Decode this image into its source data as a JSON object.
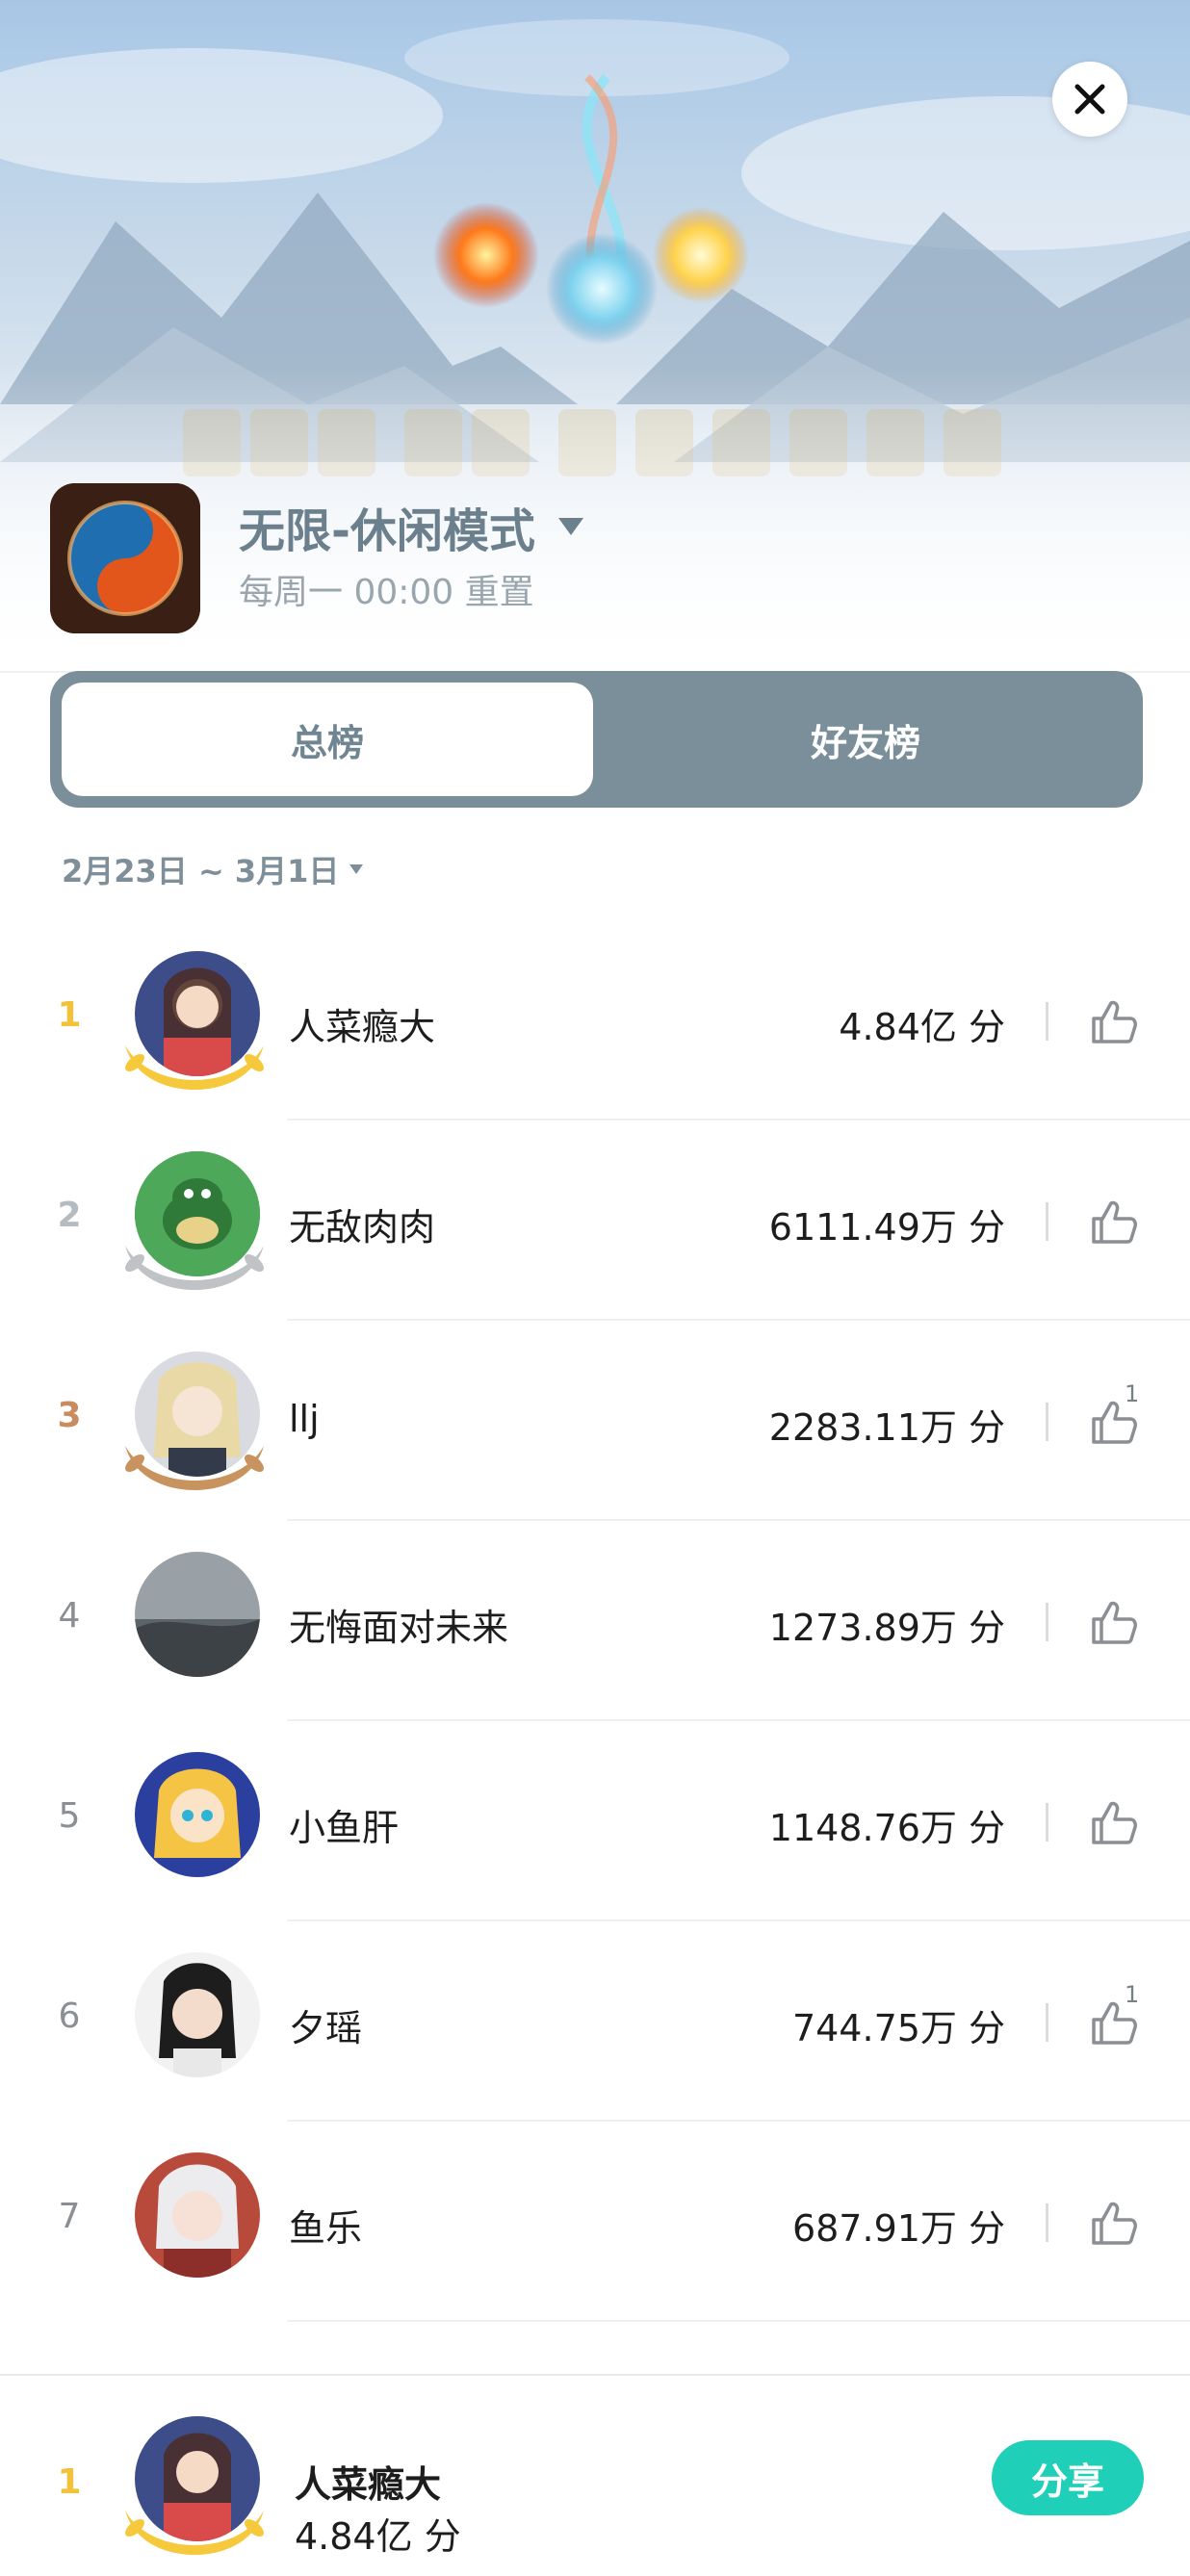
{
  "header": {
    "mode_title": "无限-休闲模式",
    "reset_text": "每周一 00:00 重置"
  },
  "tabs": [
    {
      "label": "总榜",
      "active": true
    },
    {
      "label": "好友榜",
      "active": false
    }
  ],
  "date_range": "2月23日 ~ 3月1日",
  "leaderboard": [
    {
      "rank": "1",
      "name": "人菜瘾大",
      "score": "4.84亿 分",
      "likes": ""
    },
    {
      "rank": "2",
      "name": "无敌肉肉",
      "score": "6111.49万 分",
      "likes": ""
    },
    {
      "rank": "3",
      "name": "llj",
      "score": "2283.11万 分",
      "likes": "1"
    },
    {
      "rank": "4",
      "name": "无悔面对未来",
      "score": "1273.89万 分",
      "likes": ""
    },
    {
      "rank": "5",
      "name": "小鱼肝",
      "score": "1148.76万 分",
      "likes": ""
    },
    {
      "rank": "6",
      "name": "夕瑶",
      "score": "744.75万 分",
      "likes": "1"
    },
    {
      "rank": "7",
      "name": "鱼乐",
      "score": "687.91万 分",
      "likes": ""
    }
  ],
  "my_entry": {
    "rank": "1",
    "name": "人菜瘾大",
    "score": "4.84亿 分"
  },
  "share_label": "分享",
  "colors": {
    "accent": "#1fcfb8",
    "tab_bar": "#7a8f9a",
    "gold": "#f1c23a",
    "silver": "#b5bcc1",
    "bronze": "#c98b60"
  }
}
